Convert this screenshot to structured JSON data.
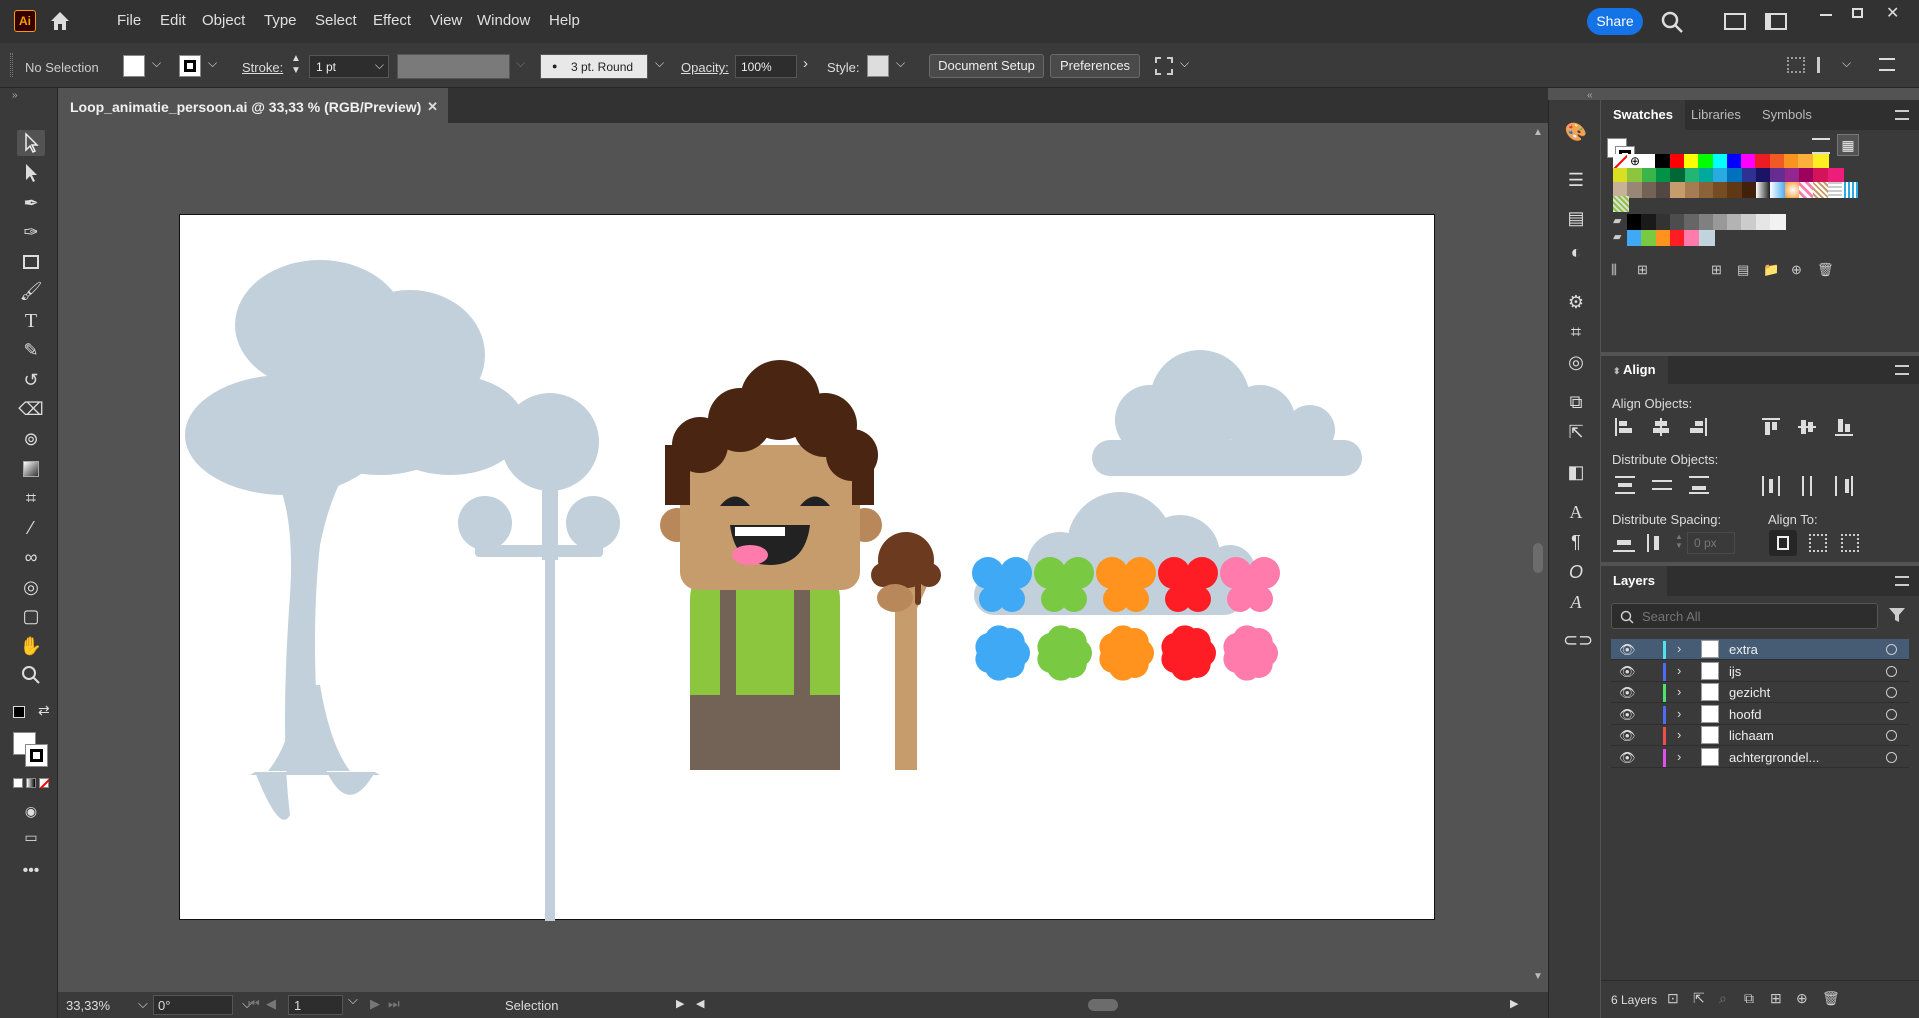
{
  "app": {
    "logo": "Ai",
    "share_label": "Share"
  },
  "menu": [
    "File",
    "Edit",
    "Object",
    "Type",
    "Select",
    "Effect",
    "View",
    "Window",
    "Help"
  ],
  "control": {
    "selection_label": "No Selection",
    "stroke_label": "Stroke:",
    "stroke_value": "1 pt",
    "brush_value": "3 pt. Round",
    "opacity_label": "Opacity:",
    "opacity_value": "100%",
    "style_label": "Style:",
    "document_setup": "Document Setup",
    "preferences": "Preferences"
  },
  "document": {
    "tab_title": "Loop_animatie_persoon.ai @ 33,33 % (RGB/Preview)"
  },
  "status": {
    "zoom": "33,33%",
    "rotation": "0°",
    "artboard": "1",
    "tool": "Selection"
  },
  "swatches_panel": {
    "tabs": [
      "Swatches",
      "Libraries",
      "Symbols"
    ],
    "row1": [
      "#ffffff",
      "#000000",
      "#ff0000",
      "#ffff00",
      "#00ff00",
      "#00ffff",
      "#0000ff",
      "#ff00ff",
      "#ed1c24",
      "#f15a24",
      "#f7931e",
      "#fbb03b",
      "#fcee21"
    ],
    "row2": [
      "#d9e021",
      "#8cc63f",
      "#39b54a",
      "#009245",
      "#006837",
      "#22b573",
      "#00a99d",
      "#29abe2",
      "#0071bc",
      "#2e3192",
      "#1b1464",
      "#662d91",
      "#93278f",
      "#9e005d",
      "#d4145a",
      "#ed1e79"
    ],
    "row3": [
      "#c7b299",
      "#998675",
      "#736357",
      "#534741",
      "#c69c6d",
      "#a67c52",
      "#8c6239",
      "#754c24",
      "#603813",
      "#42210b"
    ],
    "row5": [
      "#000000",
      "#1a1a1a",
      "#333333",
      "#4d4d4d",
      "#666666",
      "#808080",
      "#999999",
      "#b3b3b3",
      "#cccccc",
      "#e6e6e6",
      "#f2f2f2"
    ],
    "row6": [
      "#3fa9f5",
      "#7ac943",
      "#ff931e",
      "#ff1d25",
      "#ff7bac",
      "#c1d4de"
    ]
  },
  "align_panel": {
    "title": "Align",
    "align_objects": "Align Objects:",
    "distribute_objects": "Distribute Objects:",
    "distribute_spacing": "Distribute Spacing:",
    "align_to": "Align To:",
    "spacing_value": "0 px"
  },
  "layers_panel": {
    "title": "Layers",
    "search_placeholder": "Search All",
    "count_label": "6 Layers",
    "layers": [
      {
        "name": "extra",
        "color": "#4ee3f0",
        "selected": true
      },
      {
        "name": "ijs",
        "color": "#4f6bf5"
      },
      {
        "name": "gezicht",
        "color": "#4ee36b"
      },
      {
        "name": "hoofd",
        "color": "#4f6bf5"
      },
      {
        "name": "lichaam",
        "color": "#f04e4e"
      },
      {
        "name": "achtergrondel...",
        "color": "#e34ef0"
      }
    ]
  },
  "artwork_colors": {
    "silhouette": "#c1d0da",
    "hair": "#4a2511",
    "skin": "#c69c6d",
    "shirt": "#8cc63f",
    "suspenders": "#736357",
    "pants": "#736357",
    "icecream": "#6b3a1f",
    "butterflies": [
      "#3fa9f5",
      "#7ac943",
      "#ff931e",
      "#ff1d25",
      "#ff7bac"
    ]
  }
}
